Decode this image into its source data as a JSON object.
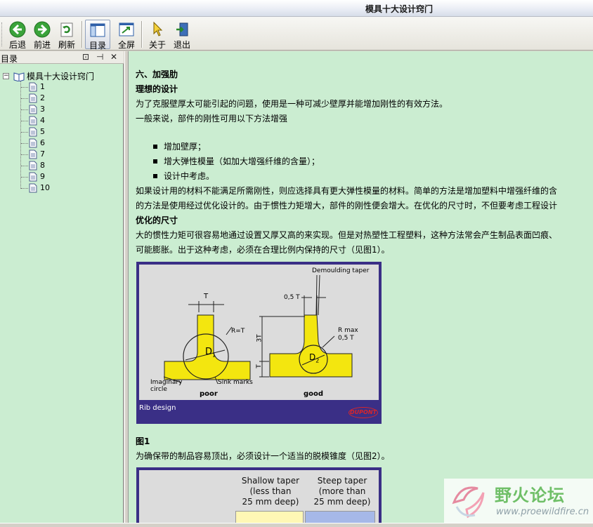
{
  "window": {
    "title": "模具十大设计窍门"
  },
  "toolbar": {
    "back": "后退",
    "forward": "前进",
    "refresh": "刷新",
    "toc": "目录",
    "fullscreen": "全屏",
    "about": "关于",
    "exit": "退出"
  },
  "left_pane": {
    "title": "目录",
    "pin_glyph": "⊡",
    "autohide_glyph": "⊣",
    "close_glyph": "✕",
    "tree": {
      "root": "模具十大设计窍门",
      "children": [
        "1",
        "2",
        "3",
        "4",
        "5",
        "6",
        "7",
        "8",
        "9",
        "10"
      ]
    }
  },
  "article": {
    "section_heading": "六、加强肋",
    "sub1": "理想的设计",
    "p1": "为了克服壁厚太可能引起的问题，使用是一种可减少壁厚并能增加刚性的有效方法。",
    "p2": "一般来说，部件的刚性可用以下方法增强",
    "bullets": [
      "增加壁厚；",
      "增大弹性模量（如加大增强纤维的含量）；",
      "设计中考虑。"
    ],
    "p3_line1": "如果设计用的材料不能满足所需刚性，则应选择具有更大弹性模量的材料。简单的方法是增加塑料中增强纤维的含",
    "p3_line2": "的方法是使用经过优化设计的。由于惯性力矩增大，部件的刚性便会增大。在优化的尺寸时，不但要考虑工程设计",
    "sub2": "优化的尺寸",
    "p4_line1": "大的惯性力矩可很容易地通过设置又厚又高的来实现。但是对热塑性工程塑料，这种方法常会产生制品表面凹痕、",
    "p4_line2": "可能膨胀。出于这种考虑，必须在合理比例内保持的尺寸（见图1）。",
    "fig1_caption": "图1",
    "p5": "为确保带的制品容易顶出，必须设计一个适当的脱模锥度（见图2）。"
  },
  "figure1": {
    "labels": {
      "demoulding": "Demoulding taper",
      "t_top": "T",
      "t_half": "0,5 T",
      "r_eq": "R=T",
      "three_t": "3T",
      "t_side": "T",
      "r_max": "R max",
      "r_max_val": "0,5 T",
      "d1": "D",
      "d1_sub": "1",
      "d2": "D",
      "d2_sub": "2",
      "imaginary": "Imaginary",
      "circle": "circle",
      "sink": "Sink marks",
      "poor": "poor",
      "good": "good",
      "footer": "Rib design",
      "logo": "DUPONT"
    },
    "colors": {
      "rib": "#f3e60f",
      "frame": "#3a2f86",
      "logo": "#d8262a"
    }
  },
  "figure2": {
    "col1_l1": "Shallow taper",
    "col1_l2": "(less than",
    "col1_l3": "25 mm deep)",
    "col2_l1": "Steep taper",
    "col2_l2": "(more than",
    "col2_l3": "25 mm deep)"
  },
  "watermark": {
    "title": "野火论坛",
    "url": "www.proewildfire.cn"
  }
}
